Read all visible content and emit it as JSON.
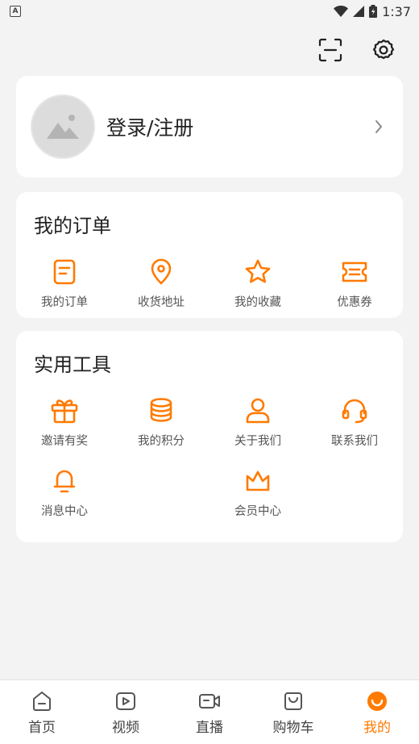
{
  "status": {
    "time": "1:37",
    "left_badge": "A"
  },
  "profile": {
    "login_label": "登录/注册"
  },
  "orders": {
    "title": "我的订单",
    "items": [
      {
        "label": "我的订单",
        "icon": "order-list-icon"
      },
      {
        "label": "收货地址",
        "icon": "location-pin-icon"
      },
      {
        "label": "我的收藏",
        "icon": "star-icon"
      },
      {
        "label": "优惠券",
        "icon": "coupon-icon"
      }
    ]
  },
  "tools": {
    "title": "实用工具",
    "items": [
      {
        "label": "邀请有奖",
        "icon": "gift-icon"
      },
      {
        "label": "我的积分",
        "icon": "coins-icon"
      },
      {
        "label": "关于我们",
        "icon": "person-icon"
      },
      {
        "label": "联系我们",
        "icon": "headset-icon"
      },
      {
        "label": "消息中心",
        "icon": "bell-icon"
      },
      {
        "label": "会员中心",
        "icon": "crown-icon"
      }
    ]
  },
  "nav": {
    "items": [
      {
        "label": "首页",
        "icon": "home-icon"
      },
      {
        "label": "视频",
        "icon": "video-icon"
      },
      {
        "label": "直播",
        "icon": "live-camera-icon"
      },
      {
        "label": "购物车",
        "icon": "cart-icon"
      },
      {
        "label": "我的",
        "icon": "profile-face-icon"
      }
    ],
    "active_index": 4
  },
  "colors": {
    "accent": "#ff7a00",
    "background": "#f3f3f3",
    "card": "#ffffff"
  }
}
